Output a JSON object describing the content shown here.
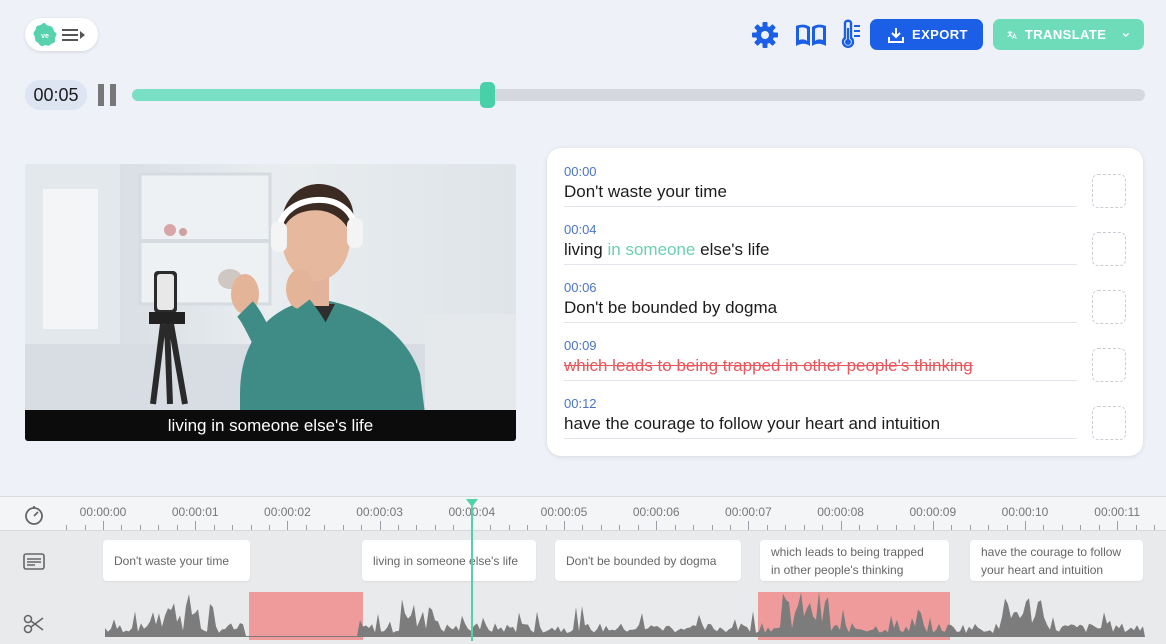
{
  "header": {
    "logo_icon": "flower-logo-icon",
    "menu_icon": "menu-expand-icon",
    "settings_icon": "gear-icon",
    "dictionary_icon": "book-icon",
    "temperature_icon": "thermometer-icon",
    "export_label": "EXPORT",
    "translate_label": "TRANSLATE",
    "accent": "#1a5fe6",
    "mint": "#6fdcb9"
  },
  "player": {
    "current_time": "00:05",
    "state": "playing",
    "progress_fraction": 0.35
  },
  "video": {
    "caption": "living in someone else's life"
  },
  "transcript": {
    "segments": [
      {
        "time": "00:00",
        "text": "Don't waste your time"
      },
      {
        "time": "00:04",
        "text_before": "living",
        "text_in": "in",
        "text_highlight": "someone",
        "text_after": "else's life"
      },
      {
        "time": "00:06",
        "text": "Don't be bounded by dogma"
      },
      {
        "time": "00:09",
        "text": "which leads to being trapped in other people's thinking",
        "deleted": true
      },
      {
        "time": "00:12",
        "text": "have the courage to follow your heart and intuition"
      }
    ]
  },
  "timeline": {
    "ticks": [
      "00:00:00",
      "00:00:01",
      "00:00:02",
      "00:00:03",
      "00:00:04",
      "00:00:05",
      "00:00:06",
      "00:00:07",
      "00:00:08",
      "00:00:09",
      "00:00:10",
      "00:00:11"
    ],
    "clips": [
      {
        "line1": "Don't waste your time"
      },
      {
        "line1": "living in someone else's life"
      },
      {
        "line1": "Don't be bounded by dogma"
      },
      {
        "line1": "which leads to being trapped",
        "line2": "in other people's thinking"
      },
      {
        "line1": "have the courage to follow",
        "line2": "your heart and intuition"
      }
    ],
    "icons": {
      "ruler": "timer-icon",
      "captions": "subtitles-icon",
      "audio": "scissors-icon"
    }
  }
}
